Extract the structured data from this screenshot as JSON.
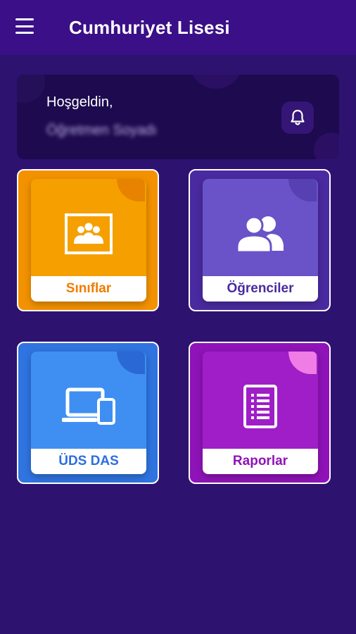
{
  "app": {
    "title": "Cumhuriyet Lisesi",
    "menu_icon": "hamburger-menu-icon"
  },
  "welcome": {
    "greeting": "Hoşgeldin,",
    "teacher_name": "Öğretmen Soyadı",
    "notification_icon": "bell-icon"
  },
  "tiles": [
    {
      "label": "Sınıflar",
      "icon": "classroom-board-icon",
      "color": "#f39200"
    },
    {
      "label": "Öğrenciler",
      "icon": "users-group-icon",
      "color": "#4a2aa0"
    },
    {
      "label": "ÜDS DAS",
      "icon": "devices-icon",
      "color": "#2f74e0"
    },
    {
      "label": "Raporlar",
      "icon": "report-document-icon",
      "color": "#8f13b8"
    }
  ],
  "colors": {
    "background": "#2e1270",
    "appbar": "#3a0f87",
    "welcome_card": "#1d0a4f"
  }
}
